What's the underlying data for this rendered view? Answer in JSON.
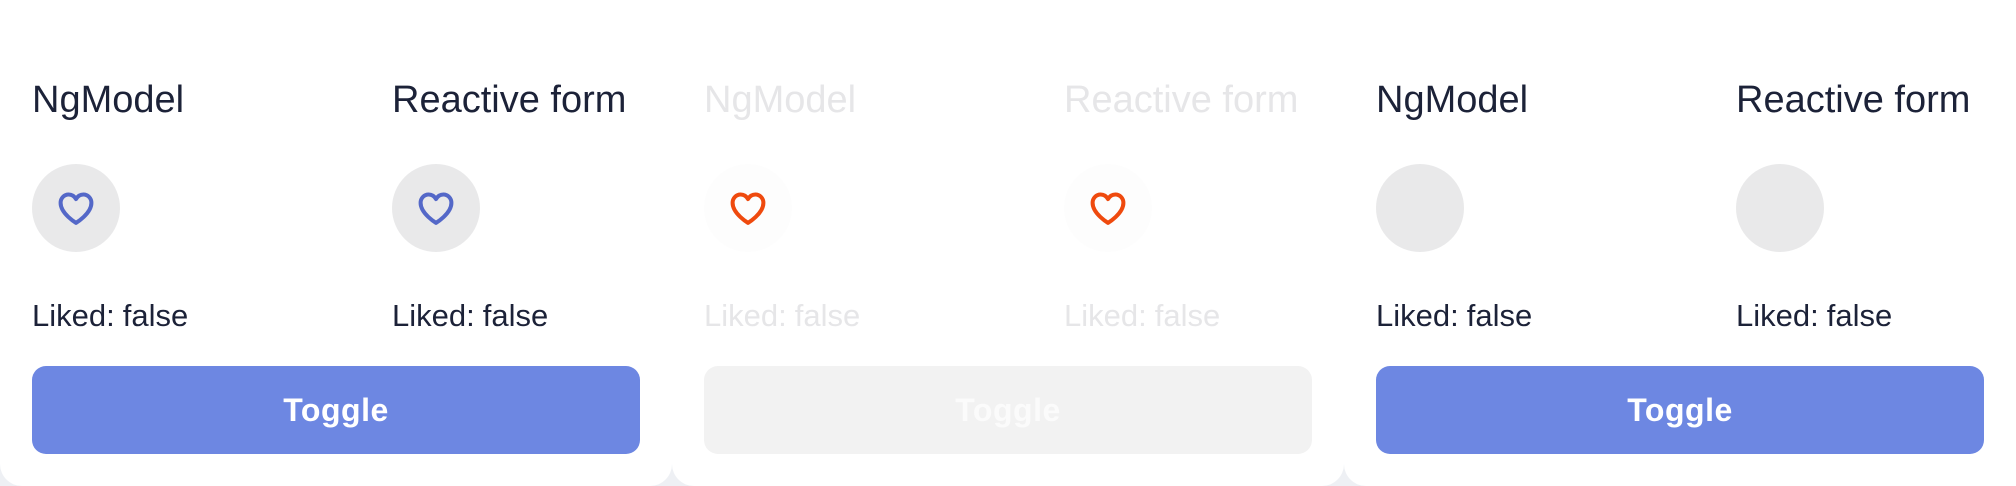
{
  "panels": [
    {
      "ngmodel": {
        "title": "NgModel",
        "liked_label": "Liked:",
        "liked_value": "false",
        "icon": "heart-outline-icon",
        "icon_color": "#5468c8",
        "button_bg": "#e9e9ea"
      },
      "reactive": {
        "title": "Reactive form",
        "liked_label": "Liked:",
        "liked_value": "false",
        "icon": "heart-outline-icon",
        "icon_color": "#5468c8",
        "button_bg": "#e9e9ea"
      },
      "toggle_label": "Toggle",
      "state": "enabled"
    },
    {
      "ngmodel": {
        "title": "NgModel",
        "liked_label": "Liked:",
        "liked_value": "false",
        "icon": "heart-outline-icon",
        "icon_color": "#ef4a0e",
        "button_bg": "#fdfdfd"
      },
      "reactive": {
        "title": "Reactive form",
        "liked_label": "Liked:",
        "liked_value": "false",
        "icon": "heart-outline-icon",
        "icon_color": "#ef4a0e",
        "button_bg": "#fdfdfd"
      },
      "toggle_label": "Toggle",
      "state": "disabled"
    },
    {
      "ngmodel": {
        "title": "NgModel",
        "liked_label": "Liked:",
        "liked_value": "false",
        "icon": "none",
        "icon_color": "",
        "button_bg": "#e9e9ea"
      },
      "reactive": {
        "title": "Reactive form",
        "liked_label": "Liked:",
        "liked_value": "false",
        "icon": "none",
        "icon_color": "",
        "button_bg": "#e9e9ea"
      },
      "toggle_label": "Toggle",
      "state": "enabled"
    }
  ],
  "colors": {
    "accent": "#6d87e2",
    "text": "#1c2238",
    "disabled_text": "#e6e6e8",
    "disabled_button": "#f2f2f2"
  }
}
